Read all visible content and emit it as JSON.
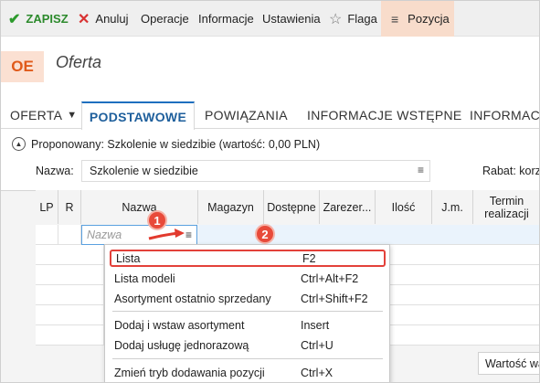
{
  "toolbar": {
    "save": "ZAPISZ",
    "cancel": "Anuluj",
    "operations": "Operacje",
    "info": "Informacje",
    "settings": "Ustawienia",
    "flag": "Flaga",
    "position": "Pozycja"
  },
  "header": {
    "logo": "OE",
    "title": "Oferta"
  },
  "tabs": [
    {
      "label": "OFERTA"
    },
    {
      "label": "PODSTAWOWE"
    },
    {
      "label": "POWIĄZANIA"
    },
    {
      "label": "INFORMACJE WSTĘPNE"
    },
    {
      "label": "INFORMACJE"
    }
  ],
  "proposal": {
    "text": "Proponowany: Szkolenie w siedzibie (wartość: 0,00 PLN)"
  },
  "form": {
    "name_label": "Nazwa:",
    "name_value": "Szkolenie w siedzibie",
    "rabat_label": "Rabat: korzyst"
  },
  "grid": {
    "columns": [
      "LP",
      "R",
      "Nazwa",
      "Magazyn",
      "Dostępne",
      "Zarezer...",
      "Ilość",
      "J.m.",
      "Termin realizacji"
    ],
    "name_placeholder": "Nazwa"
  },
  "callouts": [
    "1",
    "2"
  ],
  "context_menu": {
    "items": [
      {
        "label": "Lista",
        "shortcut": "F2"
      },
      {
        "label": "Lista modeli",
        "shortcut": "Ctrl+Alt+F2"
      },
      {
        "label": "Asortyment ostatnio sprzedany",
        "shortcut": "Ctrl+Shift+F2"
      },
      {
        "label": "Dodaj i wstaw asortyment",
        "shortcut": "Insert"
      },
      {
        "label": "Dodaj usługę jednorazową",
        "shortcut": "Ctrl+U"
      },
      {
        "label": "Zmień tryb dodawania pozycji",
        "shortcut": "Ctrl+X"
      }
    ]
  },
  "footer": {
    "value_label": "Wartość wa"
  },
  "colors": {
    "save_green": "#2c8a2c",
    "cancel_red": "#d83232",
    "active_tab": "#1e5f9c",
    "position_bg": "#f8dccb",
    "callout_red": "#e84a3a"
  },
  "icons": [
    "check-icon",
    "x-icon",
    "star-icon",
    "hamburger-icon",
    "chevron-down-icon",
    "collapse-icon",
    "arrow-icon"
  ]
}
